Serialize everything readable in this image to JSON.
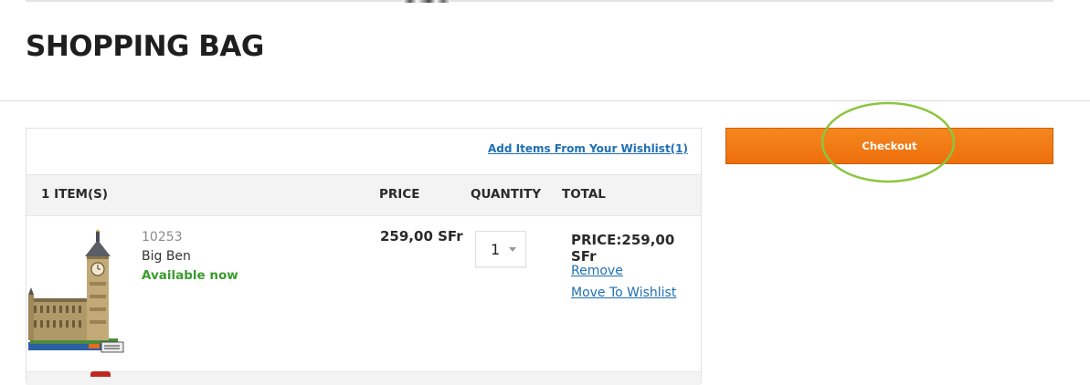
{
  "header": {
    "title": "SHOPPING BAG"
  },
  "cart": {
    "wishlist_link": "Add Items From Your Wishlist(1)",
    "columns": {
      "items": "1 ITEM(S)",
      "price": "PRICE",
      "quantity": "QUANTITY",
      "total": "TOTAL"
    },
    "items": [
      {
        "sku": "10253",
        "name": "Big Ben",
        "availability": "Available now",
        "price": "259,00 SFr",
        "quantity": "1",
        "total": "PRICE:259,00 SFr",
        "remove_label": "Remove",
        "move_label": "Move To Wishlist",
        "image_icon": "big-ben-set-image"
      }
    ]
  },
  "checkout": {
    "label": "Checkout"
  },
  "colors": {
    "accent": "#f07c16",
    "link": "#1f6fb4",
    "available": "#3a9b2e",
    "highlight": "#8cc63f"
  }
}
